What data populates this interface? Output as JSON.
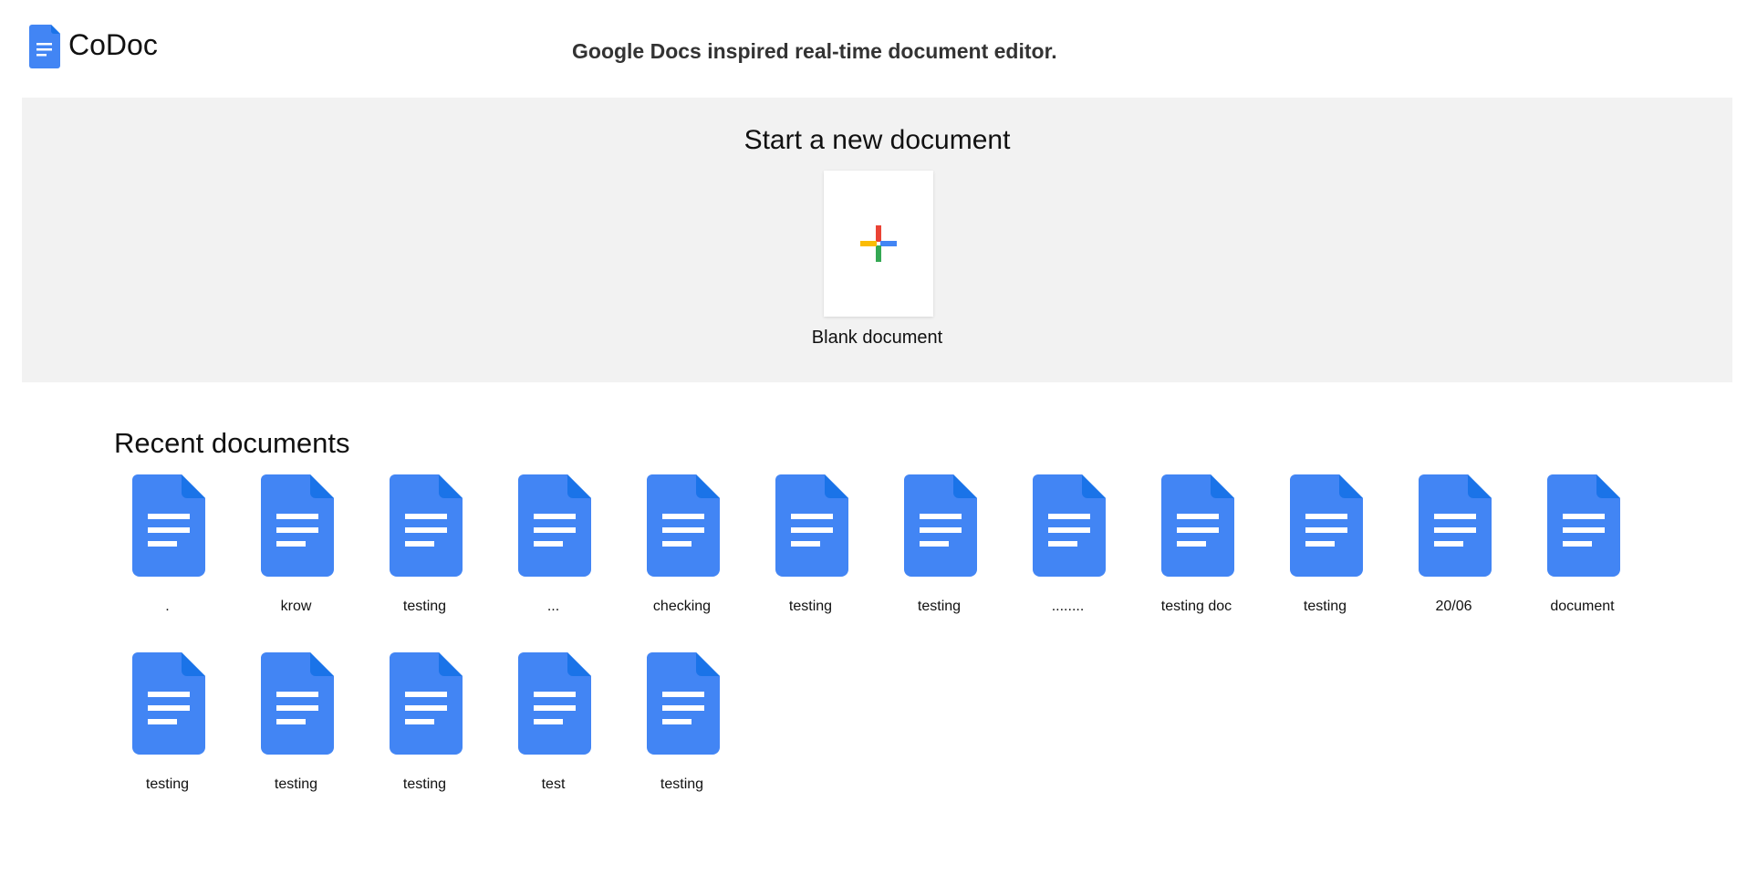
{
  "app": {
    "name": "CoDoc",
    "tagline": "Google Docs inspired real-time document editor.",
    "logo_icon": "document-icon",
    "brand_color": "#4285F4"
  },
  "start": {
    "title": "Start a new document",
    "blank_label": "Blank document",
    "plus_icon": "plus-icon",
    "plus_colors": [
      "#EA4335",
      "#4285F4",
      "#34A853",
      "#FBBC04"
    ]
  },
  "recent": {
    "title": "Recent documents",
    "documents": [
      {
        "title": "."
      },
      {
        "title": "krow"
      },
      {
        "title": "testing"
      },
      {
        "title": "..."
      },
      {
        "title": "checking"
      },
      {
        "title": "testing"
      },
      {
        "title": "testing"
      },
      {
        "title": "........"
      },
      {
        "title": "testing doc"
      },
      {
        "title": "testing"
      },
      {
        "title": "20/06"
      },
      {
        "title": "document"
      },
      {
        "title": "testing"
      },
      {
        "title": "testing"
      },
      {
        "title": "testing"
      },
      {
        "title": "test"
      },
      {
        "title": "testing"
      }
    ]
  }
}
